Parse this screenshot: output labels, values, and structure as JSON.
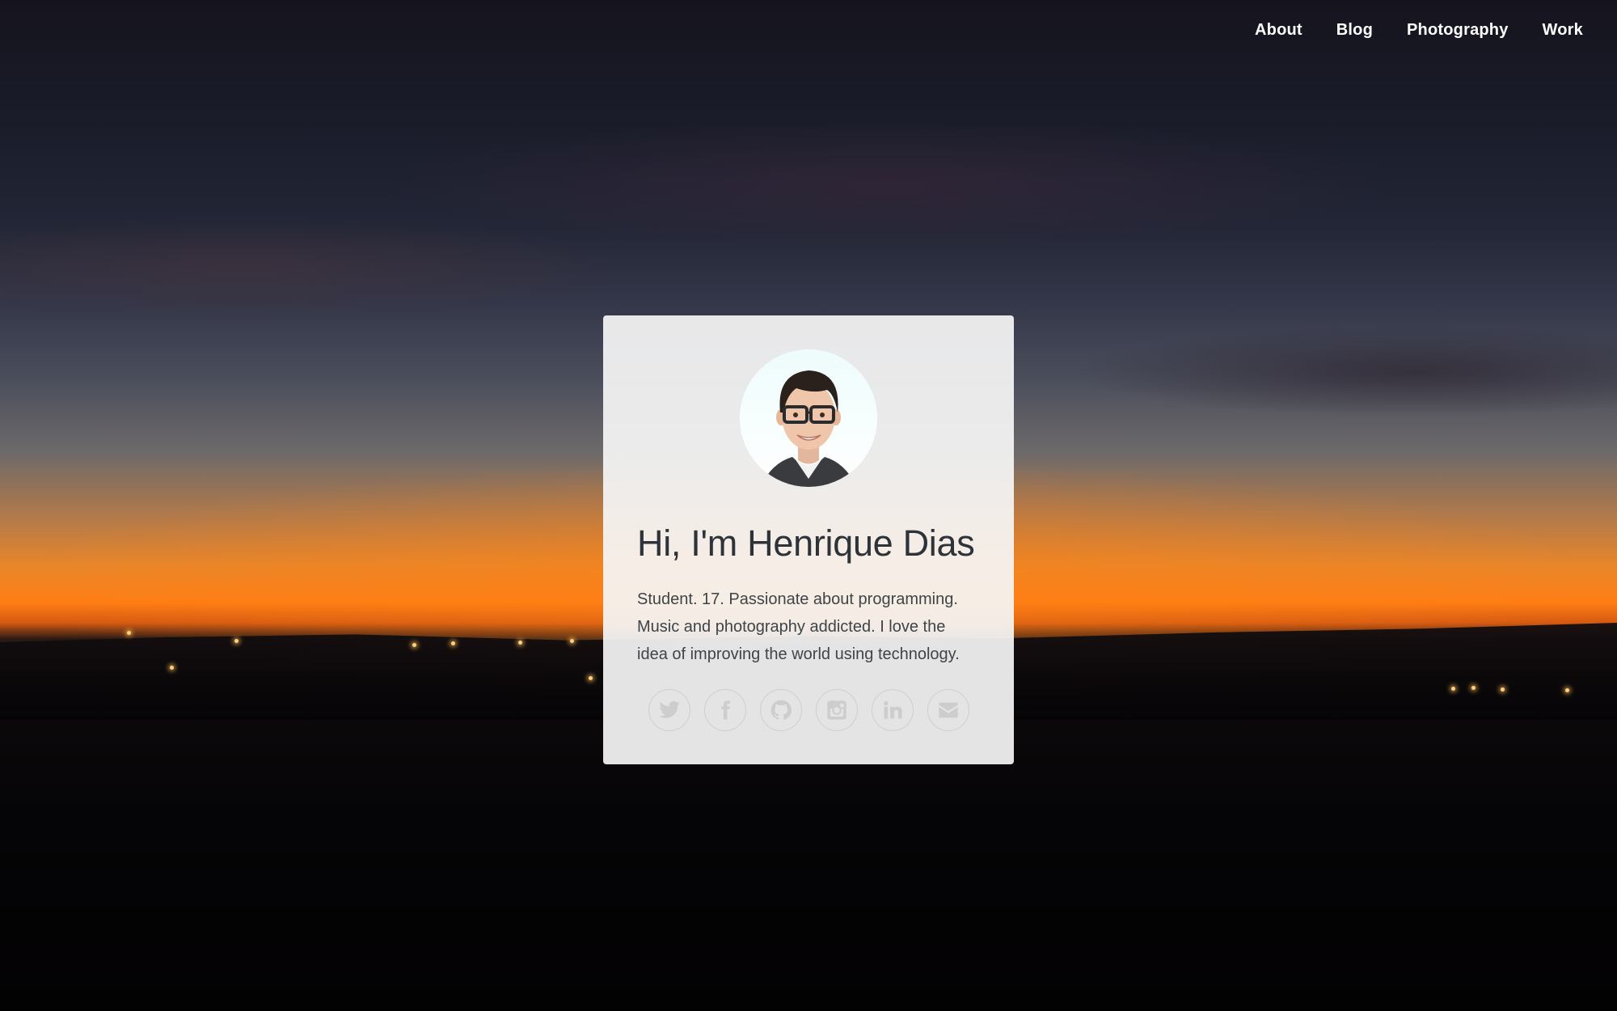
{
  "nav": {
    "items": [
      {
        "label": "About"
      },
      {
        "label": "Blog"
      },
      {
        "label": "Photography"
      },
      {
        "label": "Work"
      }
    ]
  },
  "profile": {
    "title": "Hi, I'm Henrique Dias",
    "bio": "Student. 17. Passionate about programming. Music and photography addicted. I love the idea of improving the world using technology."
  },
  "socials": [
    {
      "icon": "twitter-icon"
    },
    {
      "icon": "facebook-icon"
    },
    {
      "icon": "github-icon"
    },
    {
      "icon": "instagram-icon"
    },
    {
      "icon": "linkedin-icon"
    },
    {
      "icon": "email-icon"
    }
  ],
  "colors": {
    "title": "#2d3338",
    "text": "#3f4448",
    "icon": "#cdcdcd",
    "nav": "#ffffff"
  }
}
